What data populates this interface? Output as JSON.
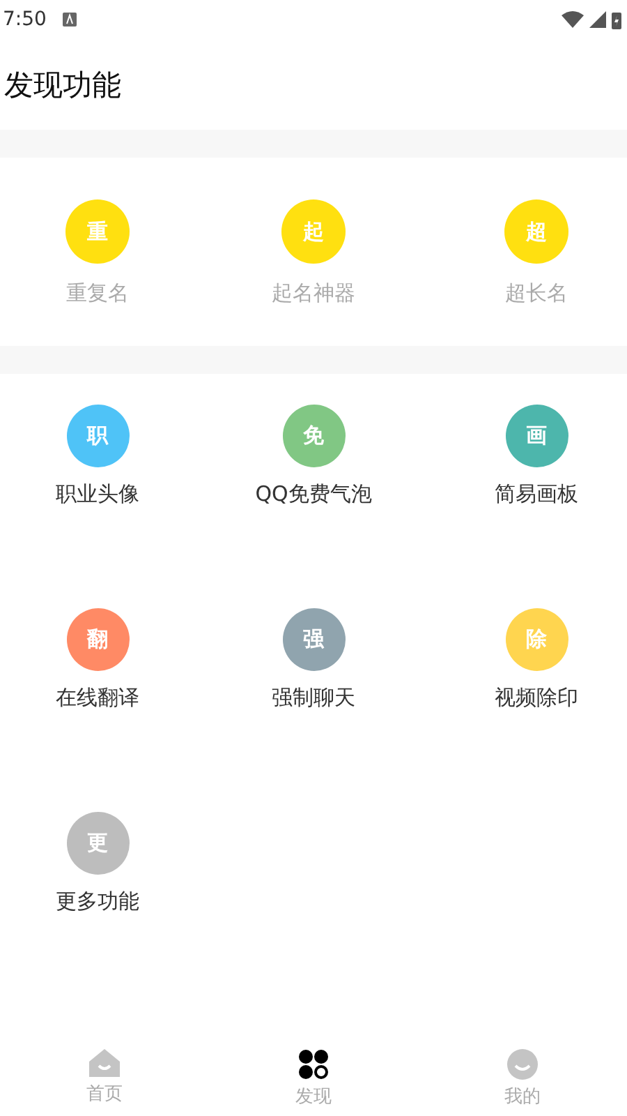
{
  "status_bar": {
    "time": "7:50"
  },
  "title": "发现功能",
  "sections": [
    {
      "items": [
        {
          "glyph": "重",
          "label": "重复名",
          "color": "#ffe010",
          "disabled": true
        },
        {
          "glyph": "起",
          "label": "起名神器",
          "color": "#ffe010",
          "disabled": true
        },
        {
          "glyph": "超",
          "label": "超长名",
          "color": "#ffe010",
          "disabled": true
        }
      ]
    },
    {
      "items": [
        {
          "glyph": "职",
          "label": "职业头像",
          "color": "#4fc3f7",
          "disabled": false
        },
        {
          "glyph": "免",
          "label": "QQ免费气泡",
          "color": "#81c784",
          "disabled": false
        },
        {
          "glyph": "画",
          "label": "简易画板",
          "color": "#4db6ac",
          "disabled": false
        },
        {
          "glyph": "翻",
          "label": "在线翻译",
          "color": "#ff8a65",
          "disabled": false
        },
        {
          "glyph": "强",
          "label": "强制聊天",
          "color": "#90a4ae",
          "disabled": false
        },
        {
          "glyph": "除",
          "label": "视频除印",
          "color": "#ffd54f",
          "disabled": false
        },
        {
          "glyph": "更",
          "label": "更多功能",
          "color": "#bdbdbd",
          "disabled": false
        }
      ]
    }
  ],
  "tab_bar": [
    {
      "kind": "home",
      "label": "首页",
      "selected": false
    },
    {
      "kind": "discover",
      "label": "发现",
      "selected": true
    },
    {
      "kind": "me",
      "label": "我的",
      "selected": false
    }
  ]
}
